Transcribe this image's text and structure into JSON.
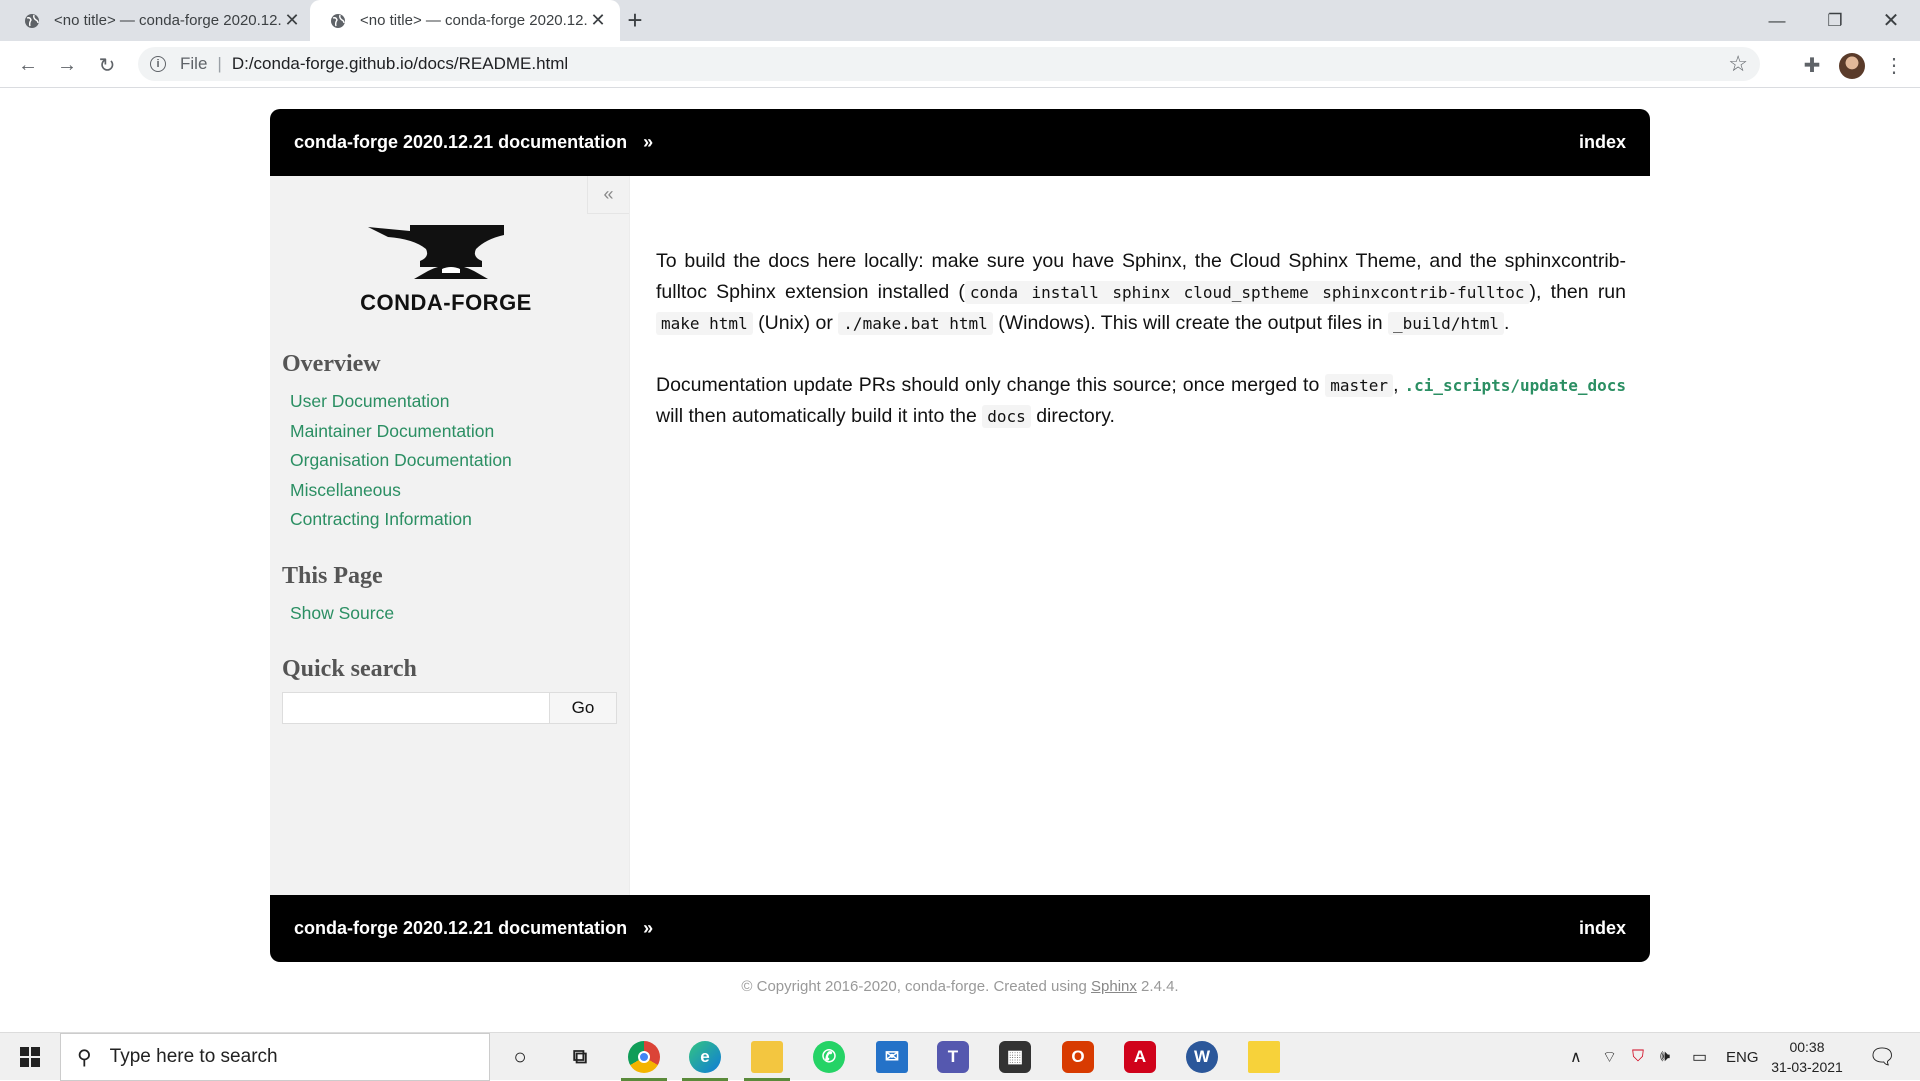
{
  "browser": {
    "tabs": [
      {
        "title": "<no title> — conda-forge 2020.12.21 documentation",
        "active": false,
        "icon": "globe-icon"
      },
      {
        "title": "<no title> — conda-forge 2020.12.21 documentation",
        "active": true,
        "icon": "globe-icon"
      }
    ],
    "address": {
      "scheme_label": "File",
      "url": "D:/conda-forge.github.io/docs/README.html"
    }
  },
  "page": {
    "header": {
      "project": "conda-forge 2020.12.21 documentation",
      "raquo": "»",
      "index_link": "index"
    },
    "sidebar": {
      "collapse_label": "«",
      "logo_text": "CONDA-FORGE",
      "overview_heading": "Overview",
      "overview_links": [
        "User Documentation",
        "Maintainer Documentation",
        "Organisation Documentation",
        "Miscellaneous",
        "Contracting Information"
      ],
      "this_page_heading": "This Page",
      "show_source": "Show Source",
      "quick_search_heading": "Quick search",
      "search_value": "",
      "go_button": "Go"
    },
    "content": {
      "p1": {
        "t1": "To build the docs here locally: make sure you have Sphinx, the Cloud Sphinx Theme, and the sphinxcontrib-fulltoc Sphinx extension installed (",
        "c1": "conda install sphinx cloud_sptheme sphinxcontrib-fulltoc",
        "t2": "), then run ",
        "c2": "make html",
        "t3": " (Unix) or ",
        "c3": "./make.bat html",
        "t4": " (Windows). This will create the output files in ",
        "c4": "_build/html",
        "t5": "."
      },
      "p2": {
        "t1": "Documentation update PRs should only change this source; once merged to ",
        "c1": "master",
        "t2": ", ",
        "link": ".ci_scripts/update_docs",
        "t3": " will then automatically build it into the ",
        "c2": "docs",
        "t4": " directory."
      }
    },
    "footer": {
      "text_before": "© Copyright 2016-2020, conda-forge. Created using ",
      "sphinx_link": "Sphinx",
      "text_after": " 2.4.4."
    }
  },
  "taskbar": {
    "search_placeholder": "Type here to search",
    "language": "ENG",
    "time": "00:38",
    "date": "31-03-2021",
    "colors": {
      "chrome": "#4285f4",
      "edge": "#0f7bd8",
      "explorer": "#f3c640",
      "whatsapp": "#25d366",
      "mail": "#2472c8",
      "teams": "#5558af",
      "store": "#333333",
      "office": "#d83b01",
      "acrobat": "#d0021b",
      "word": "#2b579a",
      "notes": "#f7d23a"
    }
  }
}
